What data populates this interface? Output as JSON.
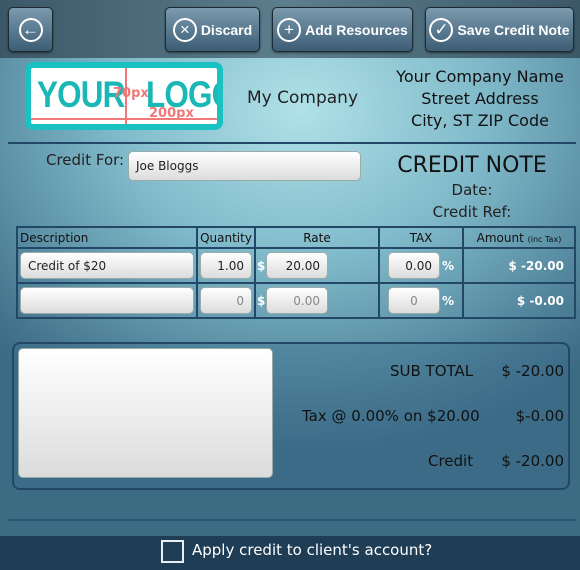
{
  "toolbar": {
    "back_icon": "arrow-left-circle-icon",
    "discard": "Discard",
    "add_resources": "Add Resources",
    "save": "Save Credit Note"
  },
  "logo": {
    "text_left": "YOUR",
    "text_right": "LOGO",
    "height_label": "70px",
    "width_label": "200px"
  },
  "company": {
    "display_name": "My Company",
    "name": "Your Company Name",
    "street": "Street Address",
    "city": "City, ST ZIP Code"
  },
  "credit_for": {
    "label": "Credit For:",
    "value": "Joe Bloggs"
  },
  "doc": {
    "title": "CREDIT NOTE",
    "date_label": "Date:",
    "ref_label": "Credit Ref:"
  },
  "table": {
    "headers": {
      "description": "Description",
      "quantity": "Quantity",
      "rate": "Rate",
      "tax": "TAX",
      "amount": "Amount",
      "amount_note": "(inc Tax)"
    },
    "currency": "$",
    "percent": "%",
    "rows": [
      {
        "description": "Credit of $20",
        "quantity": "1.00",
        "rate": "20.00",
        "tax": "0.00",
        "amount": "$ -20.00"
      },
      {
        "description": "",
        "quantity": "0",
        "rate": "0.00",
        "tax": "0",
        "amount": "$ -0.00"
      }
    ]
  },
  "summary": {
    "subtotal_label": "SUB TOTAL",
    "subtotal": "$ -20.00",
    "tax_label": "Tax @ 0.00% on $20.00",
    "tax": "$-0.00",
    "credit_label": "Credit",
    "credit": "$ -20.00"
  },
  "footer": {
    "apply_label": "Apply credit to client's account?",
    "checked": false
  }
}
